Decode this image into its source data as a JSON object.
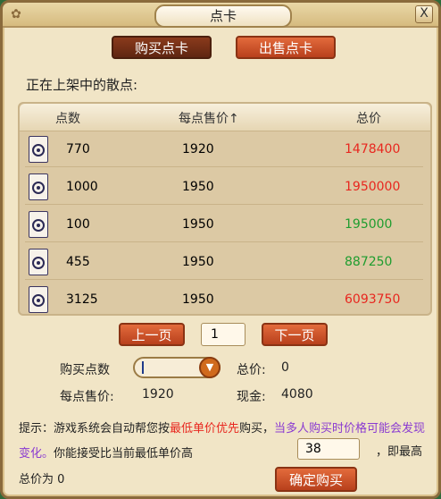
{
  "window": {
    "title": "点卡",
    "close_label": "X",
    "corner_icon": "gourd-icon"
  },
  "tabs": {
    "buy": "购买点卡",
    "sell": "出售点卡"
  },
  "section_label": "正在上架中的散点:",
  "table": {
    "headers": {
      "points": "点数",
      "unit_price": "每点售价↑",
      "total": "总价"
    },
    "rows": [
      {
        "points": "770",
        "unit_price": "1920",
        "total": "1478400",
        "total_color": "#e8271f"
      },
      {
        "points": "1000",
        "unit_price": "1950",
        "total": "1950000",
        "total_color": "#e8271f"
      },
      {
        "points": "100",
        "unit_price": "1950",
        "total": "195000",
        "total_color": "#1f9d2f"
      },
      {
        "points": "455",
        "unit_price": "1950",
        "total": "887250",
        "total_color": "#1f9d2f"
      },
      {
        "points": "3125",
        "unit_price": "1950",
        "total": "6093750",
        "total_color": "#e8271f"
      }
    ]
  },
  "pagination": {
    "prev": "上一页",
    "page": "1",
    "next": "下一页"
  },
  "purchase": {
    "points_label": "购买点数",
    "points_value": "",
    "total_label": "总价:",
    "total_value": "0",
    "unit_price_label": "每点售价:",
    "unit_price_value": "1920",
    "cash_label": "现金:",
    "cash_value": "4080"
  },
  "tip": {
    "prefix": "提示：游戏系统会自动帮您按",
    "highlight_red": "最低单价优先",
    "middle": "购买，",
    "highlight_purple": "当多人购买时价格可能会发现变化。",
    "suffix1": "你能接受比当前最低单价高",
    "input_value": "38",
    "suffix2": "，即最高",
    "suffix3": "总价为 0"
  },
  "confirm_button": "确定购买",
  "colors": {
    "red": "#e8271f",
    "green": "#1f9d2f",
    "purple": "#8a3bd1"
  }
}
